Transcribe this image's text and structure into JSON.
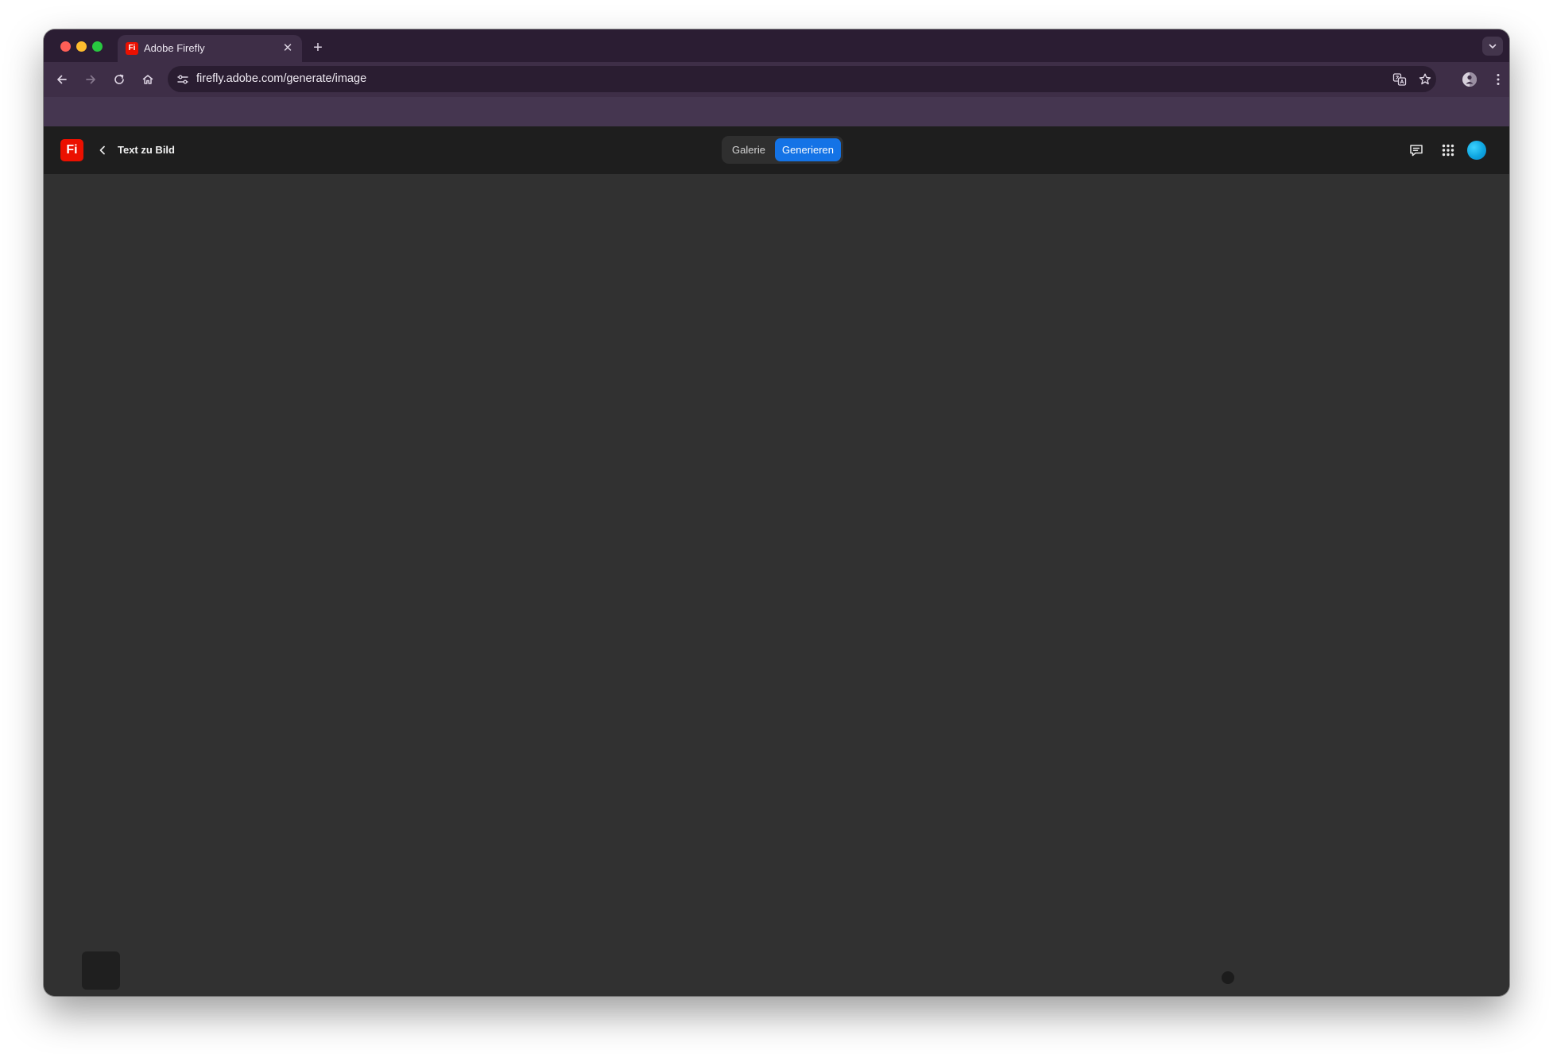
{
  "browser": {
    "tab": {
      "title": "Adobe Firefly",
      "favicon_text": "Fi",
      "close_glyph": "✕"
    },
    "new_tab_glyph": "+",
    "tab_search_glyph": "⌄",
    "address_bar": {
      "url": "firefly.adobe.com/generate/image"
    },
    "icons": [
      "back-arrow-icon",
      "forward-arrow-icon",
      "reload-icon",
      "home-icon",
      "site-info-icon",
      "translate-icon",
      "bookmark-star-icon",
      "profile-icon",
      "kebab-menu-icon"
    ]
  },
  "app": {
    "logo_text": "Fi",
    "page_title": "Text zu Bild",
    "segmented": {
      "gallery_label": "Galerie",
      "generate_label": "Generieren",
      "active": "Generieren"
    },
    "colors": {
      "brand_red": "#eb1000",
      "accent_blue": "#1473e6",
      "header_bg": "#1e1e1e",
      "content_bg": "#313131"
    },
    "header_icons": [
      "feedback-icon",
      "app-switcher-icon",
      "avatar"
    ]
  }
}
